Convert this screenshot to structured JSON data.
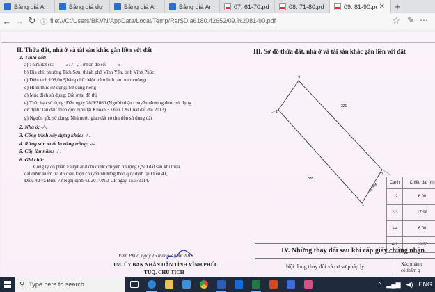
{
  "browser": {
    "tabs": [
      {
        "label": "Bảng giá An Phú R",
        "icon": "doc-icon",
        "active": false
      },
      {
        "label": "Bảng giá dự án Mc",
        "icon": "doc-icon",
        "active": false
      },
      {
        "label": "Bảng giá An Phú R",
        "icon": "doc-icon",
        "active": false
      },
      {
        "label": "Bảng giá An Phú R",
        "icon": "doc-icon",
        "active": false
      },
      {
        "label": "07. 61-70.pdf",
        "icon": "pdf-icon",
        "active": false
      },
      {
        "label": "08. 71-80.pdf",
        "icon": "pdf-icon",
        "active": false
      },
      {
        "label": "09. 81-90.pdf",
        "icon": "pdf-icon",
        "active": true
      }
    ],
    "new_tab": "+",
    "url": "file:///C:/Users/BKVN/AppData/Local/Temp/Rar$DIa6180.42652/09.%2081-90.pdf"
  },
  "document": {
    "section2_title": "II. Thửa đất, nhà ở và tài sản khác gắn liền với đất",
    "land_title": "1. Thửa đất:",
    "parcel_no_label": "a) Thửa đất số:",
    "parcel_no": "317",
    "map_sheet_label": ", Tờ bản đồ số:",
    "map_sheet": "5",
    "address": "b) Địa chỉ: phường Tích Sơn, thành phố Vĩnh Yên, tỉnh Vĩnh Phúc",
    "area": "c) Diện tích:108,0m²(bằng chữ: Một trăm linh tám mét vuông)",
    "usage_form": "d) Hình thức sử dụng: Sử dụng riêng",
    "usage_purpose": "đ) Mục đích sử dụng: Đất ở tại đô thị",
    "usage_term": "e) Thời hạn sử dụng: Đến ngày 28/9/2060 (Người nhận chuyển nhượng được sử dụng",
    "usage_term_2": "ổn định \"lâu dài\" theo quy định tại Khoản 3 Điều 126 Luật đất đai 2013)",
    "origin": "g) Nguồn gốc sử dụng: Nhà nước giao đất có thu tiền sử dụng đất",
    "house": "2. Nhà ở: -/-.",
    "construction": "3. Công trình xây dựng khác: -/-.",
    "forest": "4. Rừng sản xuất là rừng trồng: -/-.",
    "perennial": "5. Cây lâu năm: -/-.",
    "notes_title": "6. Ghi chú:",
    "notes_1": "Công ty cổ phần FairyLand chỉ được chuyển nhượng QSD đất sau khi thửa",
    "notes_2": "đất được kiểm tra đủ điều kiện chuyển nhượng theo quy định tại Điều 41,",
    "notes_3": "Điều 42 và Điều 72 Nghị định 43/2014/NĐ-CP ngày 15/5/2014.",
    "date_line": "Vĩnh Phúc, ngày 15 tháng 7 năm 2018",
    "authority": "TM. ỦY BAN NHÂN DÂN TỈNH VĨNH PHÚC",
    "chairman": "TUQ. CHỦ TỊCH",
    "section3_title": "III. Sơ đồ thửa đất, nhà ở và tài sản khác gắn liền với đất",
    "diagram_labels": {
      "n1": "1",
      "n2": "2",
      "n3": "3",
      "n4": "4",
      "d323": "323",
      "d321": "321",
      "d335": "335",
      "road": "đường"
    },
    "length_table": {
      "head_1": "Cạnh",
      "head_2": "Chiều dài (m)",
      "rows": [
        {
          "edge": "1-2",
          "len": "6.00"
        },
        {
          "edge": "2-3",
          "len": "17.98"
        },
        {
          "edge": "3-4",
          "len": "6.00"
        },
        {
          "edge": "4-1",
          "len": "18.00"
        }
      ]
    },
    "section4_title": "IV. Những thay đổi sau khi cấp giấy chứng nhận",
    "col_content": "Nội dung thay đổi và cơ sở pháp lý",
    "col_confirm": "Xác nhận c",
    "col_confirm_2": "có thẩm q"
  },
  "taskbar": {
    "search_placeholder": "Type here to search",
    "apps": [
      "task-view-icon",
      "edge-icon",
      "file-explorer-icon",
      "store-icon",
      "chrome-icon",
      "word-icon",
      "zalo-icon",
      "excel-icon",
      "powerpoint-icon",
      "photos-icon",
      "media-icon"
    ],
    "lang": "ENG"
  }
}
